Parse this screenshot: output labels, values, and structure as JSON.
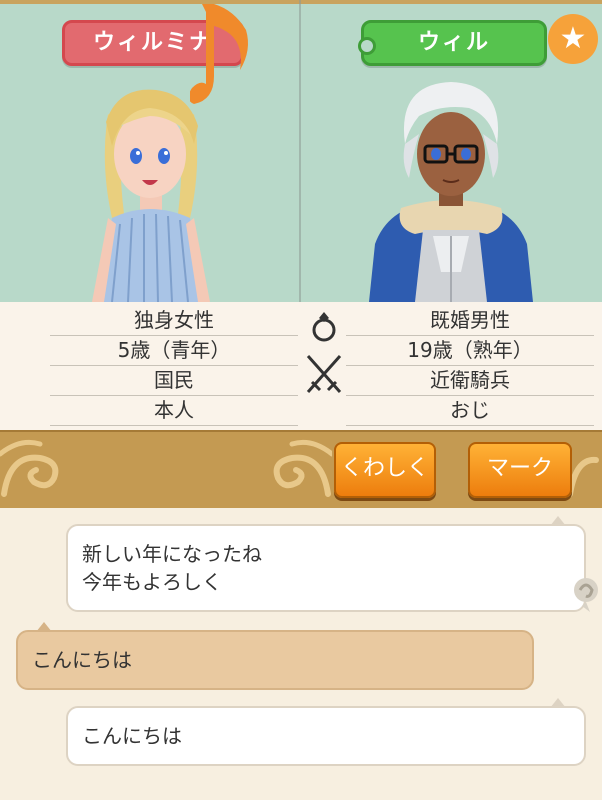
{
  "left_character": {
    "name": "ウィルミナ",
    "info": [
      "独身女性",
      "5歳（青年）",
      "国民",
      "本人"
    ]
  },
  "right_character": {
    "name": "ウィル",
    "info": [
      "既婚男性",
      "19歳（熟年）",
      "近衛騎兵",
      "おじ"
    ]
  },
  "buttons": {
    "detail": "くわしく",
    "mark": "マーク"
  },
  "chat": {
    "messages": [
      {
        "side": "right",
        "lines": [
          "新しい年になったね",
          "今年もよろしく"
        ]
      },
      {
        "side": "left",
        "lines": [
          "こんにちは"
        ]
      },
      {
        "side": "right",
        "lines": [
          "こんにちは"
        ]
      }
    ]
  },
  "colors": {
    "portrait_bg": "#b8d9c9",
    "female_tag": "#e26a6f",
    "male_tag": "#56c34e",
    "star_badge": "#f6a23a",
    "banner": "#c49a52",
    "button": "#f08a14",
    "incoming_bubble": "#e9c9a0"
  },
  "icons": [
    "music-note-icon",
    "star-icon",
    "ring-icon",
    "crossed-swords-icon",
    "speaker-icon"
  ]
}
